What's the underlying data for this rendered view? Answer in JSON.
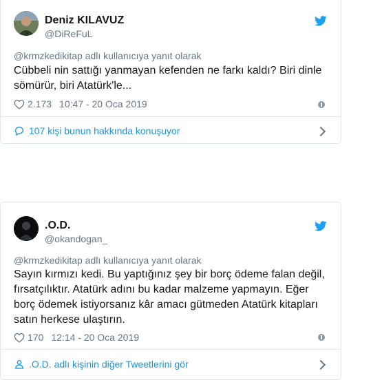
{
  "colors": {
    "link": "#1b95e0",
    "muted": "#657786",
    "border": "#e1e8ed",
    "twitter_blue": "#1da1f2"
  },
  "tweets": [
    {
      "name": "Deniz KILAVUZ",
      "handle": "@DiReFuL",
      "reply_to": "@krmzkedikitap adlı kullanıcıya yanıt olarak",
      "text": "Cübbeli nin sattığı yanmayan kefenden ne farkı kaldı? Biri dinle sömürür, biri Atatürk'le...",
      "likes": "2.173",
      "timestamp": "10:47 - 20 Oca 2019",
      "footer": "107 kişi bunun hakkında konuşuyor",
      "footer_icon": "comment-icon"
    },
    {
      "name": ".O.D.",
      "handle": "@okandogan_",
      "reply_to": "@krmzkedikitap adlı kullanıcıya yanıt olarak",
      "text": "Sayın kırmızı kedi. Bu yaptığınız şey bir borç ödeme falan değil, fırsatçılıktır. Atatürk adını bu kadar malzeme yapmayın. Eğer borç ödemek istiyorsanız kâr amacı gütmeden Atatürk kitapları satın herkese ulaştırın.",
      "likes": "170",
      "timestamp": "12:14 - 20 Oca 2019",
      "footer": ".O.D. adlı kişinin diğer Tweetlerini gör",
      "footer_icon": "user-icon"
    }
  ]
}
